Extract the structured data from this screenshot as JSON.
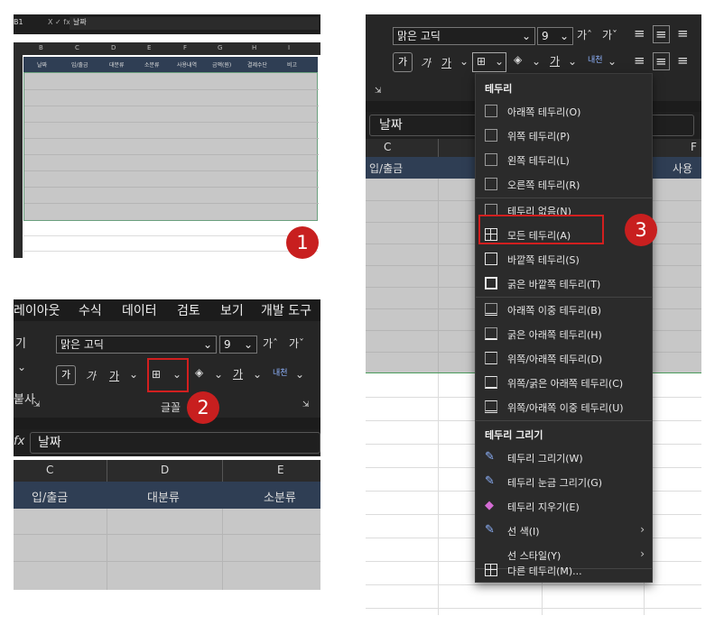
{
  "panel1": {
    "cell_ref": "B1",
    "fx_glyphs": "X ✓ fx",
    "formula_value": "날짜",
    "col_letters": [
      "B",
      "C",
      "D",
      "E",
      "F",
      "G",
      "H",
      "I"
    ],
    "headers": [
      "날짜",
      "입/출금",
      "대분류",
      "소분류",
      "사용내역",
      "금액(원)",
      "결제수단",
      "비고"
    ],
    "step": "1"
  },
  "panel2": {
    "menu_tabs": [
      "레이아웃",
      "수식",
      "데이터",
      "검토",
      "보기",
      "개발 도구"
    ],
    "left_labels": [
      "기",
      "붙사"
    ],
    "font_name": "맑은 고딕",
    "font_size": "9",
    "bold": "가",
    "italic": "가",
    "underline": "가",
    "group_label": "글꼴",
    "formula_value": "날짜",
    "fx": "fx",
    "col_letters": [
      "C",
      "D",
      "E"
    ],
    "headers": [
      "입/출금",
      "대분류",
      "소분류"
    ],
    "step": "2"
  },
  "panel3": {
    "font_name": "맑은 고딕",
    "font_size": "9",
    "bold": "가",
    "italic": "가",
    "underline": "가",
    "formula_value": "날짜",
    "col_letters": [
      "C",
      "F"
    ],
    "headers": [
      "입/출금",
      "사용나"
    ],
    "step": "3",
    "menu": {
      "title_borders": "테두리",
      "items_a": [
        "아래쪽 테두리(O)",
        "위쪽 테두리(P)",
        "왼쪽 테두리(L)",
        "오른쪽 테두리(R)"
      ],
      "items_b": [
        "테두리 없음(N)",
        "모든 테두리(A)",
        "바깥쪽 테두리(S)",
        "굵은 바깥쪽 테두리(T)"
      ],
      "items_c": [
        "아래쪽 이중 테두리(B)",
        "굵은 아래쪽 테두리(H)",
        "위쪽/아래쪽 테두리(D)",
        "위쪽/굵은 아래쪽 테두리(C)",
        "위쪽/아래쪽 이중 테두리(U)"
      ],
      "title_draw": "테두리 그리기",
      "items_draw": [
        "테두리 그리기(W)",
        "테두리 눈금 그리기(G)",
        "테두리 지우기(E)",
        "선 색(I)",
        "선 스타일(Y)"
      ],
      "more": "다른 테두리(M)..."
    }
  },
  "colors": {
    "badge": "#c81f1f",
    "header_blue": "#2f3e54",
    "grid_gray": "#c7c7c7",
    "ribbon": "#262626"
  }
}
